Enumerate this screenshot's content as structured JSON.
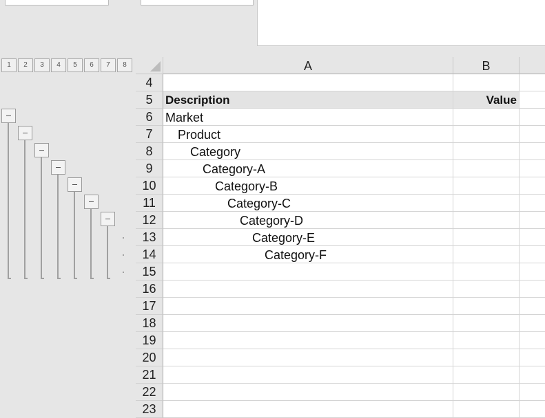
{
  "column_headers": [
    "A",
    "B"
  ],
  "outline_levels": [
    "1",
    "2",
    "3",
    "4",
    "5",
    "6",
    "7",
    "8"
  ],
  "rows": [
    {
      "num": "4",
      "a": "",
      "b": ""
    },
    {
      "num": "5",
      "a": "Description",
      "b": "Value",
      "header": true
    },
    {
      "num": "6",
      "a": "Market",
      "b": "",
      "indent": 0
    },
    {
      "num": "7",
      "a": "Product",
      "b": "",
      "indent": 1
    },
    {
      "num": "8",
      "a": "Category",
      "b": "",
      "indent": 2
    },
    {
      "num": "9",
      "a": "Category-A",
      "b": "",
      "indent": 3
    },
    {
      "num": "10",
      "a": "Category-B",
      "b": "",
      "indent": 4
    },
    {
      "num": "11",
      "a": "Category-C",
      "b": "",
      "indent": 5
    },
    {
      "num": "12",
      "a": "Category-D",
      "b": "",
      "indent": 6
    },
    {
      "num": "13",
      "a": "Category-E",
      "b": "",
      "indent": 7
    },
    {
      "num": "14",
      "a": "Category-F",
      "b": "",
      "indent": 8
    },
    {
      "num": "15",
      "a": "",
      "b": ""
    },
    {
      "num": "16",
      "a": "",
      "b": ""
    },
    {
      "num": "17",
      "a": "",
      "b": ""
    },
    {
      "num": "18",
      "a": "",
      "b": ""
    },
    {
      "num": "19",
      "a": "",
      "b": ""
    },
    {
      "num": "20",
      "a": "",
      "b": ""
    },
    {
      "num": "21",
      "a": "",
      "b": ""
    },
    {
      "num": "22",
      "a": "",
      "b": ""
    },
    {
      "num": "23",
      "a": "",
      "b": ""
    }
  ],
  "icons": {
    "collapse": "minus-icon",
    "select_all": "select-all-triangle-icon"
  }
}
